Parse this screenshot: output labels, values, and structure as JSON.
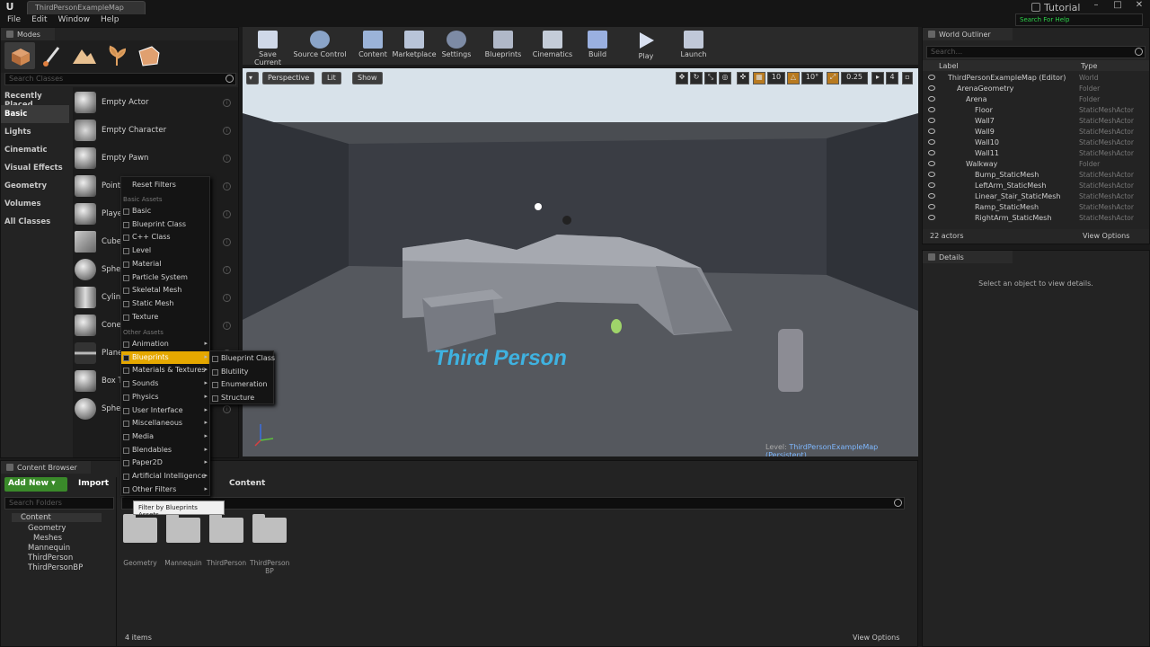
{
  "window": {
    "doc_tab": "ThirdPersonExampleMap",
    "tutorial": "Tutorial",
    "search_help": "Search For Help"
  },
  "menu": [
    "File",
    "Edit",
    "Window",
    "Help"
  ],
  "modes": {
    "title": "Modes",
    "search_placeholder": "Search Classes",
    "categories": [
      "Recently Placed",
      "Basic",
      "Lights",
      "Cinematic",
      "Visual Effects",
      "Geometry",
      "Volumes",
      "All Classes"
    ],
    "selected_category": "Basic",
    "actors": [
      "Empty Actor",
      "Empty Character",
      "Empty Pawn",
      "Point",
      "Playe",
      "Cube",
      "Spher",
      "Cylin",
      "Cone",
      "Plane",
      "Box T",
      "Spher"
    ]
  },
  "filter_menu": {
    "reset": "Reset Filters",
    "basic_header": "Basic Assets",
    "basic_items": [
      "Basic",
      "Blueprint Class",
      "C++ Class",
      "Level",
      "Material",
      "Particle System",
      "Skeletal Mesh",
      "Static Mesh",
      "Texture"
    ],
    "other_header": "Other Assets",
    "other_items": [
      "Animation",
      "Blueprints",
      "Materials & Textures",
      "Sounds",
      "Physics",
      "User Interface",
      "Miscellaneous",
      "Media",
      "Blendables",
      "Paper2D",
      "Artificial Intelligence",
      "Other Filters"
    ],
    "highlighted": "Blueprints",
    "submenu": [
      "Blueprint Class",
      "Blutility",
      "Enumeration",
      "Structure"
    ],
    "tooltip": "Filter by Blueprints Assets."
  },
  "toolbar": [
    "Save Current",
    "Source Control",
    "Content",
    "Marketplace",
    "Settings",
    "Blueprints",
    "Cinematics",
    "Build",
    "Play",
    "Launch"
  ],
  "viewport": {
    "perspective": "Perspective",
    "lit": "Lit",
    "show": "Show",
    "grid_snap": "10",
    "rot_snap": "10°",
    "scale_snap": "0.25",
    "cam_speed": "4",
    "floor_text": "Third Person",
    "level_prefix": "Level:",
    "level_name": "ThirdPersonExampleMap (Persistent)"
  },
  "outliner": {
    "title": "World Outliner",
    "search_placeholder": "Search...",
    "col_label": "Label",
    "col_type": "Type",
    "rows": [
      {
        "label": "ThirdPersonExampleMap (Editor)",
        "type": "World",
        "indent": 0
      },
      {
        "label": "ArenaGeometry",
        "type": "Folder",
        "indent": 1
      },
      {
        "label": "Arena",
        "type": "Folder",
        "indent": 2
      },
      {
        "label": "Floor",
        "type": "StaticMeshActor",
        "indent": 3
      },
      {
        "label": "Wall7",
        "type": "StaticMeshActor",
        "indent": 3
      },
      {
        "label": "Wall9",
        "type": "StaticMeshActor",
        "indent": 3
      },
      {
        "label": "Wall10",
        "type": "StaticMeshActor",
        "indent": 3
      },
      {
        "label": "Wall11",
        "type": "StaticMeshActor",
        "indent": 3
      },
      {
        "label": "Walkway",
        "type": "Folder",
        "indent": 2
      },
      {
        "label": "Bump_StaticMesh",
        "type": "StaticMeshActor",
        "indent": 3
      },
      {
        "label": "LeftArm_StaticMesh",
        "type": "StaticMeshActor",
        "indent": 3
      },
      {
        "label": "Linear_Stair_StaticMesh",
        "type": "StaticMeshActor",
        "indent": 3
      },
      {
        "label": "Ramp_StaticMesh",
        "type": "StaticMeshActor",
        "indent": 3
      },
      {
        "label": "RightArm_StaticMesh",
        "type": "StaticMeshActor",
        "indent": 3
      }
    ],
    "actor_count": "22 actors",
    "view_options": "View Options"
  },
  "details": {
    "title": "Details",
    "empty_msg": "Select an object to view details."
  },
  "content_browser": {
    "title": "Content Browser",
    "add_new": "Add New",
    "import": "Import",
    "search_folders": "Search Folders",
    "path": "Content",
    "tree": [
      "Content",
      "Geometry",
      "Meshes",
      "Mannequin",
      "ThirdPerson",
      "ThirdPersonBP"
    ],
    "folders": [
      "Geometry",
      "Mannequin",
      "ThirdPerson",
      "ThirdPerson BP"
    ],
    "item_count": "4 items",
    "view_options": "View Options"
  }
}
